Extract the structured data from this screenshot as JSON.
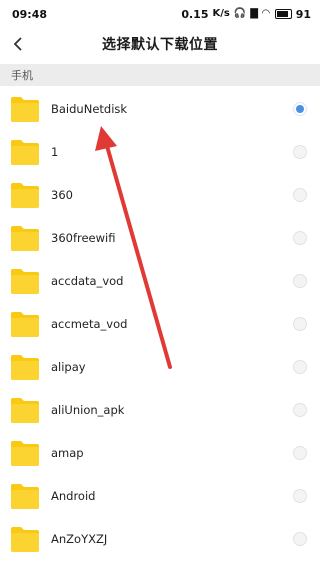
{
  "status_bar": {
    "time": "09:48",
    "network_speed": "0.15",
    "network_speed_unit": "K/s",
    "battery": "91"
  },
  "header": {
    "title": "选择默认下载位置"
  },
  "section": {
    "label": "手机"
  },
  "folders": [
    {
      "name": "BaiduNetdisk",
      "selected": true
    },
    {
      "name": "1",
      "selected": false
    },
    {
      "name": "360",
      "selected": false
    },
    {
      "name": "360freewifi",
      "selected": false
    },
    {
      "name": "accdata_vod",
      "selected": false
    },
    {
      "name": "accmeta_vod",
      "selected": false
    },
    {
      "name": "alipay",
      "selected": false
    },
    {
      "name": "aliUnion_apk",
      "selected": false
    },
    {
      "name": "amap",
      "selected": false
    },
    {
      "name": "Android",
      "selected": false
    },
    {
      "name": "AnZoYXZJ",
      "selected": false
    }
  ],
  "colors": {
    "folder": "#f9c913",
    "selected_radio": "#4a90e2",
    "annotation_arrow": "#e03a36"
  }
}
